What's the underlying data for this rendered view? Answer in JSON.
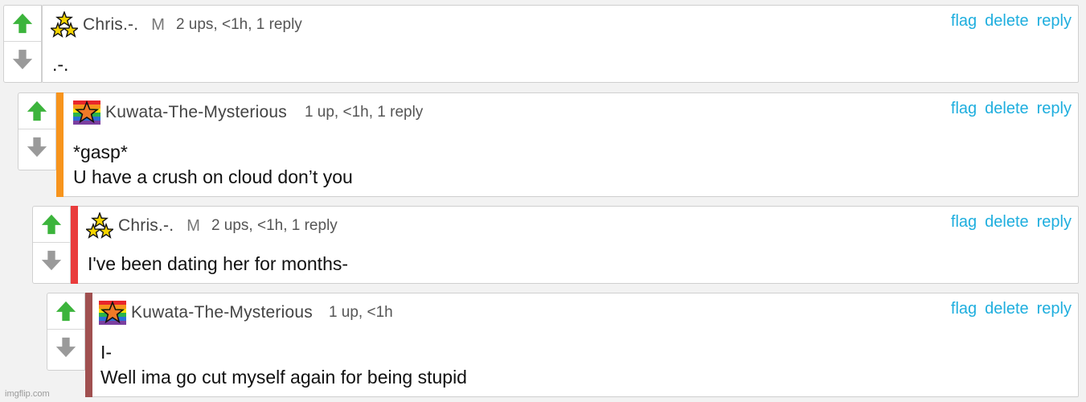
{
  "colors": {
    "link": "#1eaede",
    "up_arrow": "#3cb43c",
    "down_arrow": "#9a9a9a",
    "stripe_level1": "#f7941d",
    "stripe_level2": "#e93c3c",
    "stripe_level3": "#a05050"
  },
  "icons": {
    "upvote": "up-arrow-icon",
    "downvote": "down-arrow-icon",
    "avatar_chris": "three-stars-avatar-icon",
    "avatar_kuwata": "rainbow-star-avatar-icon"
  },
  "comments": [
    {
      "username": "Chris.-.",
      "badge": "M",
      "meta": "2 ups, <1h, 1 reply",
      "body": [
        ".-."
      ],
      "actions": {
        "flag": "flag",
        "delete": "delete",
        "reply": "reply"
      }
    },
    {
      "username": "Kuwata-The-Mysterious",
      "badge": "",
      "meta": "1 up, <1h, 1 reply",
      "body": [
        "*gasp*",
        "U have a crush on cloud don’t you"
      ],
      "actions": {
        "flag": "flag",
        "delete": "delete",
        "reply": "reply"
      }
    },
    {
      "username": "Chris.-.",
      "badge": "M",
      "meta": "2 ups, <1h, 1 reply",
      "body": [
        "I've been dating her for months-"
      ],
      "actions": {
        "flag": "flag",
        "delete": "delete",
        "reply": "reply"
      }
    },
    {
      "username": "Kuwata-The-Mysterious",
      "badge": "",
      "meta": "1 up, <1h",
      "body": [
        "I-",
        "Well ima go cut myself again for being stupid"
      ],
      "actions": {
        "flag": "flag",
        "delete": "delete",
        "reply": "reply"
      }
    }
  ],
  "watermark": "imgflip.com"
}
